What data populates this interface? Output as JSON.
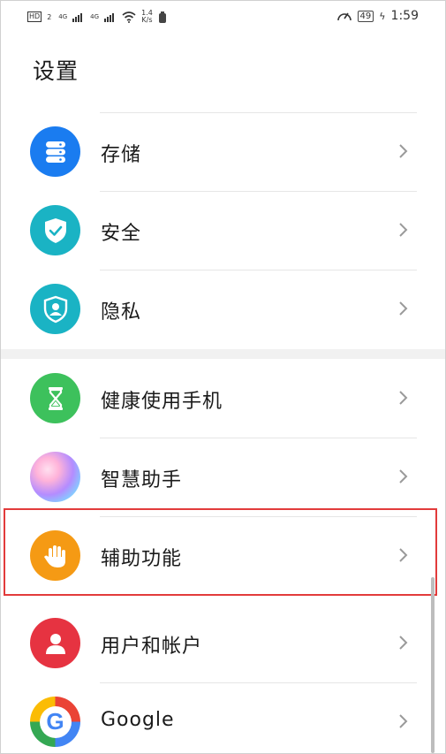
{
  "status_bar": {
    "hd_label": "HD",
    "hd_sub": "2",
    "signal1_label": "4G",
    "signal2_label": "4G",
    "net_speed_value": "1.4",
    "net_speed_unit": "K/s",
    "battery": "49",
    "time": "1:59"
  },
  "header": {
    "title": "设置"
  },
  "group1": {
    "items": [
      {
        "label": "存储",
        "icon": "storage-icon",
        "color": "#1a7cf0"
      },
      {
        "label": "安全",
        "icon": "shield-check-icon",
        "color": "#1ab3c4"
      },
      {
        "label": "隐私",
        "icon": "privacy-icon",
        "color": "#1ab3c4"
      }
    ]
  },
  "group2": {
    "items": [
      {
        "label": "健康使用手机",
        "icon": "hourglass-icon",
        "color": "#3dc15c"
      },
      {
        "label": "智慧助手",
        "icon": "assistant-orb-icon",
        "color": "#c9a6ff"
      },
      {
        "label": "辅助功能",
        "icon": "hand-icon",
        "color": "#f59a14"
      },
      {
        "label": "用户和帐户",
        "icon": "user-icon",
        "color": "#e63341"
      },
      {
        "label": "Google",
        "icon": "google-icon",
        "color": "#4285f4"
      }
    ]
  }
}
